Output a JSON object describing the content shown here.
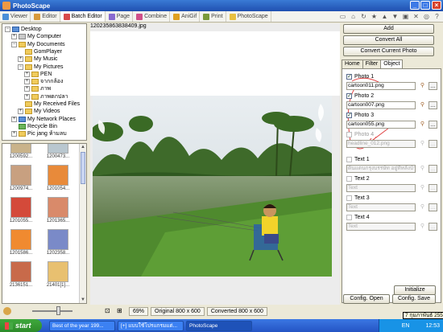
{
  "window": {
    "title": "PhotoScape"
  },
  "tabs": [
    {
      "label": "Viewer",
      "color": "#4a8fd8"
    },
    {
      "label": "Editor",
      "color": "#d89a3a"
    },
    {
      "label": "Batch Editor",
      "color": "#d84a4a",
      "active": true
    },
    {
      "label": "Page",
      "color": "#8a6bd0"
    },
    {
      "label": "Combine",
      "color": "#d0508a"
    },
    {
      "label": "AniGif",
      "color": "#e0a020"
    },
    {
      "label": "Print",
      "color": "#7a9a3a"
    },
    {
      "label": "PhotoScape",
      "color": "#e8c040"
    }
  ],
  "tree": [
    {
      "label": "Desktop",
      "level": 0,
      "exp": "-",
      "icon": "blue"
    },
    {
      "label": "My Computer",
      "level": 1,
      "exp": "+",
      "icon": "gray"
    },
    {
      "label": "My Documents",
      "level": 1,
      "exp": "-",
      "icon": "yellow"
    },
    {
      "label": "GomPlayer",
      "level": 2,
      "exp": "",
      "icon": "yellow"
    },
    {
      "label": "My Music",
      "level": 2,
      "exp": "+",
      "icon": "yellow"
    },
    {
      "label": "My Pictures",
      "level": 2,
      "exp": "-",
      "icon": "yellow"
    },
    {
      "label": "PEN",
      "level": 3,
      "exp": "+",
      "icon": "yellow"
    },
    {
      "label": "จากกล้อง",
      "level": 3,
      "exp": "+",
      "icon": "yellow"
    },
    {
      "label": "ภาพ",
      "level": 3,
      "exp": "+",
      "icon": "yellow"
    },
    {
      "label": "ภาพตกปลา",
      "level": 3,
      "exp": "+",
      "icon": "yellow",
      "selected": true
    },
    {
      "label": "My Received Files",
      "level": 2,
      "exp": "",
      "icon": "yellow"
    },
    {
      "label": "My Videos",
      "level": 2,
      "exp": "+",
      "icon": "yellow"
    },
    {
      "label": "My Network Places",
      "level": 1,
      "exp": "+",
      "icon": "blue"
    },
    {
      "label": "Recycle Bin",
      "level": 1,
      "exp": "",
      "icon": "green"
    },
    {
      "label": "Pic jang ห้ามลบ",
      "level": 1,
      "exp": "+",
      "icon": "yellow"
    }
  ],
  "thumbnails": [
    {
      "label": "1200592...",
      "color": "#c9b38a"
    },
    {
      "label": "1200473...",
      "color": "#b9c7cf"
    },
    {
      "label": "1200974...",
      "color": "#c8a080"
    },
    {
      "label": "1201054...",
      "color": "#e88a3a"
    },
    {
      "label": "1201055...",
      "color": "#d44a3a"
    },
    {
      "label": "1201365...",
      "color": "#d98a6a"
    },
    {
      "label": "1201586...",
      "color": "#f08a30"
    },
    {
      "label": "1202358...",
      "color": "#7a8ac8"
    },
    {
      "label": "2136151...",
      "color": "#c86a4a"
    },
    {
      "label": "21401[1]...",
      "color": "#e8c070"
    }
  ],
  "viewer": {
    "filename": "120235863838409.jpg"
  },
  "status": {
    "zoom": "69%",
    "original": "Original 800 x 600",
    "converted": "Converted 800 x 600"
  },
  "right": {
    "add": "Add",
    "convert_all": "Convert All",
    "convert_current": "Convert Current Photo",
    "tabs": [
      "Home",
      "Filter",
      "Object"
    ],
    "active_tab": "Object",
    "photos": [
      {
        "label": "Photo 1",
        "file": "cartoon011.png",
        "checked": true
      },
      {
        "label": "Photo 2",
        "file": "cartoon007.png",
        "checked": true
      },
      {
        "label": "Photo 3",
        "file": "cartoon055.png",
        "checked": true
      },
      {
        "label": "Photo 4",
        "file": "headline_012.png",
        "checked": false
      }
    ],
    "texts": [
      {
        "label": "Text 1",
        "value": "ดินแดนกรุงบรรษัท อยู่ที่หลังบ้าน",
        "checked": false
      },
      {
        "label": "Text 2",
        "value": "Text",
        "checked": false
      },
      {
        "label": "Text 3",
        "value": "Text",
        "checked": false
      },
      {
        "label": "Text 4",
        "value": "Text",
        "checked": false
      }
    ],
    "initialize": "Initialize",
    "config_open": "Config. Open",
    "config_save": "Config. Save"
  },
  "taskbar": {
    "start": "start",
    "items": [
      "Best of the year 199...",
      "[+] แบบใช้โปรแกรมแต่...",
      "PhotoScape"
    ],
    "active_index": 2,
    "lang": "EN",
    "time": "12:53",
    "tooltip": "7 กุมภาพันธ์ 2551"
  }
}
